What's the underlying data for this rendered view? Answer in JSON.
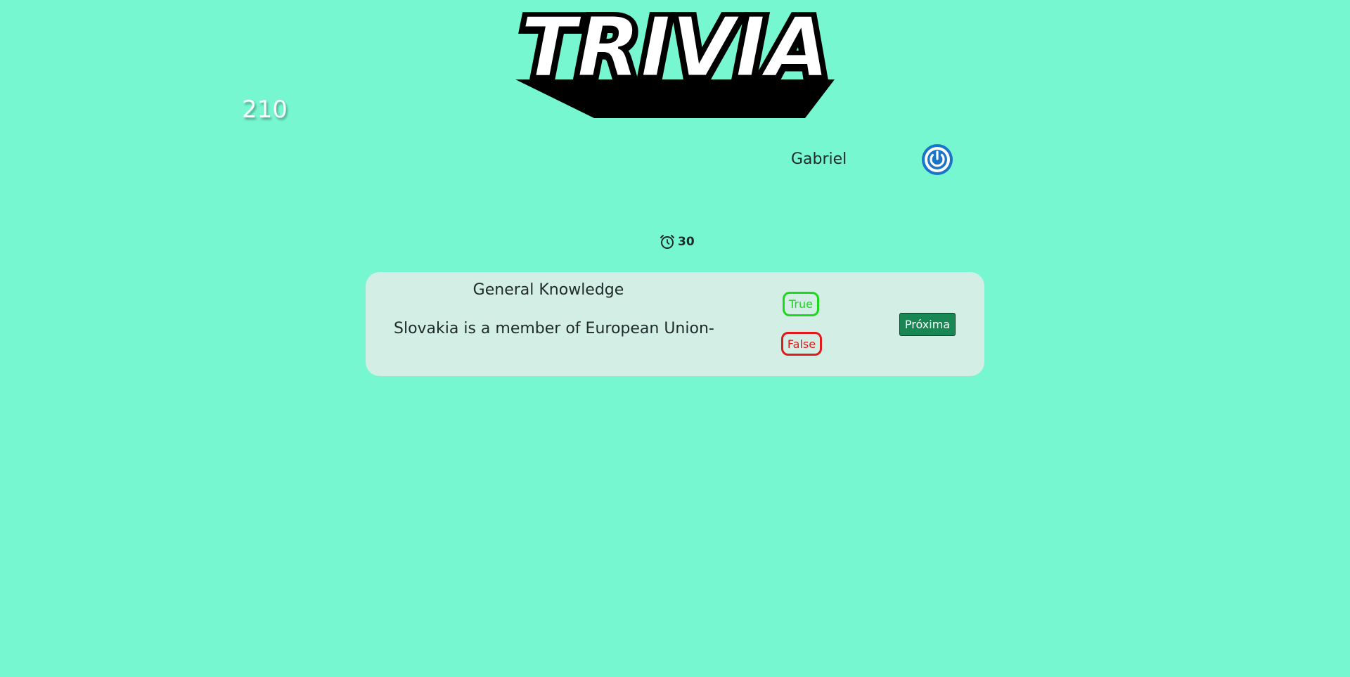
{
  "header": {
    "logo_text": "TRIVIA",
    "score": "210"
  },
  "user": {
    "name": "Gabriel",
    "logout_icon": "power-icon"
  },
  "timer": {
    "icon": "alarm-clock-icon",
    "value": "30"
  },
  "question_card": {
    "category": "General Knowledge",
    "question": "Slovakia is a member of European Union-",
    "answers": [
      {
        "label": "True"
      },
      {
        "label": "False"
      }
    ],
    "next_label": "Próxima"
  },
  "colors": {
    "background": "#77f7d0",
    "card": "#d3eee4",
    "true": "#1cd91c",
    "false": "#e01b1b",
    "next_button": "#198754",
    "logout": "#1b74c8"
  }
}
